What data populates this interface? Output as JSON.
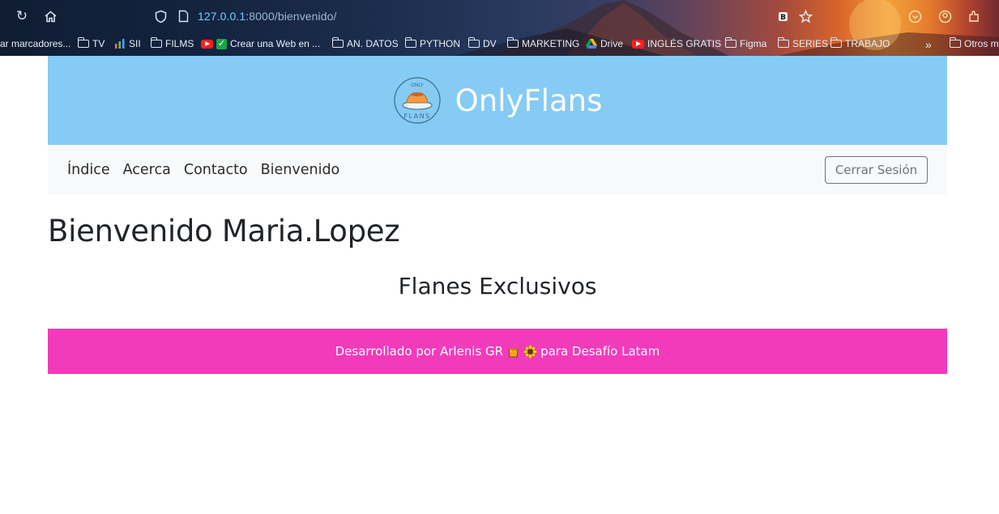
{
  "browser": {
    "url_host": "127.0.0.1",
    "url_path": ":8000/bienvenido/",
    "bookmarks": [
      {
        "label": "ar marcadores...",
        "icon": "text-only"
      },
      {
        "label": "TV",
        "icon": "folder-icon"
      },
      {
        "label": "SII",
        "icon": "chart-icon"
      },
      {
        "label": "FILMS",
        "icon": "folder-icon"
      },
      {
        "label": "Crear una Web en ...",
        "icon": "youtube-icon"
      },
      {
        "label": "AN. DATOS",
        "icon": "folder-icon"
      },
      {
        "label": "PYTHON",
        "icon": "folder-icon"
      },
      {
        "label": "DV",
        "icon": "folder-icon"
      },
      {
        "label": "MARKETING",
        "icon": "folder-icon"
      },
      {
        "label": "Drive",
        "icon": "drive-icon"
      },
      {
        "label": "INGLÉS GRATIS",
        "icon": "youtube-icon"
      },
      {
        "label": "Figma",
        "icon": "folder-icon"
      },
      {
        "label": "SERIES",
        "icon": "folder-icon"
      },
      {
        "label": "TRABAJO",
        "icon": "folder-icon"
      },
      {
        "label": "Otros m",
        "icon": "folder-icon"
      }
    ]
  },
  "header": {
    "brand": "OnlyFlans",
    "logo_top_text": "ONLY",
    "logo_bottom_text": "FLANS"
  },
  "nav": {
    "links": [
      "Índice",
      "Acerca",
      "Contacto",
      "Bienvenido"
    ],
    "logout_label": "Cerrar Sesión"
  },
  "main": {
    "welcome": "Bienvenido Maria.Lopez",
    "subtitle": "Flanes Exclusivos"
  },
  "footer": {
    "text_before": "Desarrollado por Arlenis GR",
    "text_after": "para Desafío Latam",
    "emojis": [
      "honey-pot-icon",
      "sunflower-icon"
    ]
  },
  "colors": {
    "header_bg": "#85cbf3",
    "nav_bg": "#f8f9fa",
    "footer_bg": "#f23bbb",
    "logout_border": "#6c757d"
  }
}
